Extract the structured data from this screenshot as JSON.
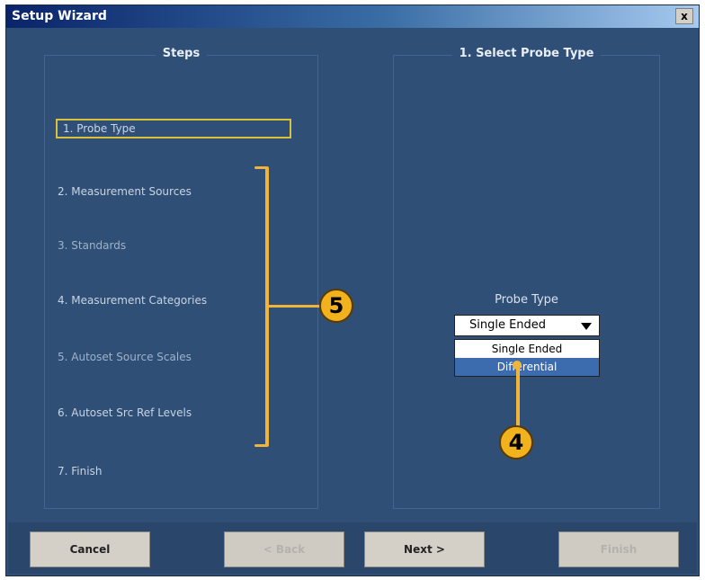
{
  "window": {
    "title": "Setup Wizard",
    "close_label": "x"
  },
  "steps_panel": {
    "heading": "Steps",
    "steps": [
      "1. Probe Type",
      "2. Measurement Sources",
      "3. Standards",
      "4. Measurement Categories",
      "5. Autoset Source Scales",
      "6. Autoset Src Ref Levels",
      "7. Finish"
    ],
    "active_index": 0
  },
  "probe_panel": {
    "heading": "1. Select Probe Type",
    "field_label": "Probe Type",
    "selected_value": "Single Ended",
    "options": [
      "Single Ended",
      "Differential"
    ],
    "highlighted_option": "Differential"
  },
  "buttons": {
    "cancel": "Cancel",
    "back": "< Back",
    "next": "Next >",
    "finish": "Finish"
  },
  "callouts": {
    "steps": "5",
    "dropdown": "4"
  },
  "colors": {
    "accent": "#f2b21d",
    "window_bg": "#2f4f76",
    "active_outline": "#d9c13a"
  }
}
